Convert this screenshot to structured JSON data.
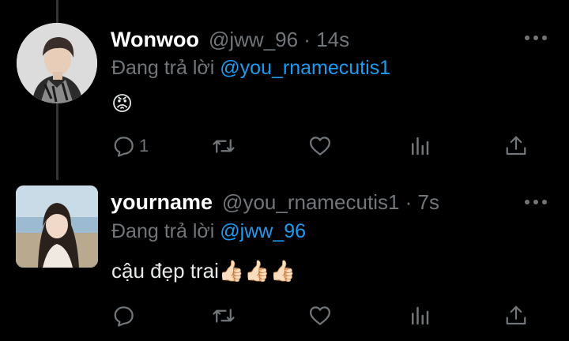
{
  "tweets": [
    {
      "name": "Wonwoo",
      "handle": "@jww_96",
      "time_sep": " · ",
      "time": "14s",
      "reply_prefix": "Đang trả lời ",
      "reply_to": "@you_rnamecutis1",
      "text": "😡",
      "reply_count": "1",
      "avatar_icon": "profile-photo"
    },
    {
      "name": "yourname",
      "handle": "@you_rnamecutis1",
      "time_sep": " · ",
      "time": "7s",
      "reply_prefix": "Đang trả lời ",
      "reply_to": "@jww_96",
      "text": "cậu đẹp trai👍🏻👍🏻👍🏻",
      "reply_count": "",
      "avatar_icon": "profile-photo"
    }
  ],
  "colors": {
    "background": "#000000",
    "name": "#ffffff",
    "secondary": "#71767b",
    "mention": "#1d9bf0",
    "thread_line": "#333639"
  }
}
